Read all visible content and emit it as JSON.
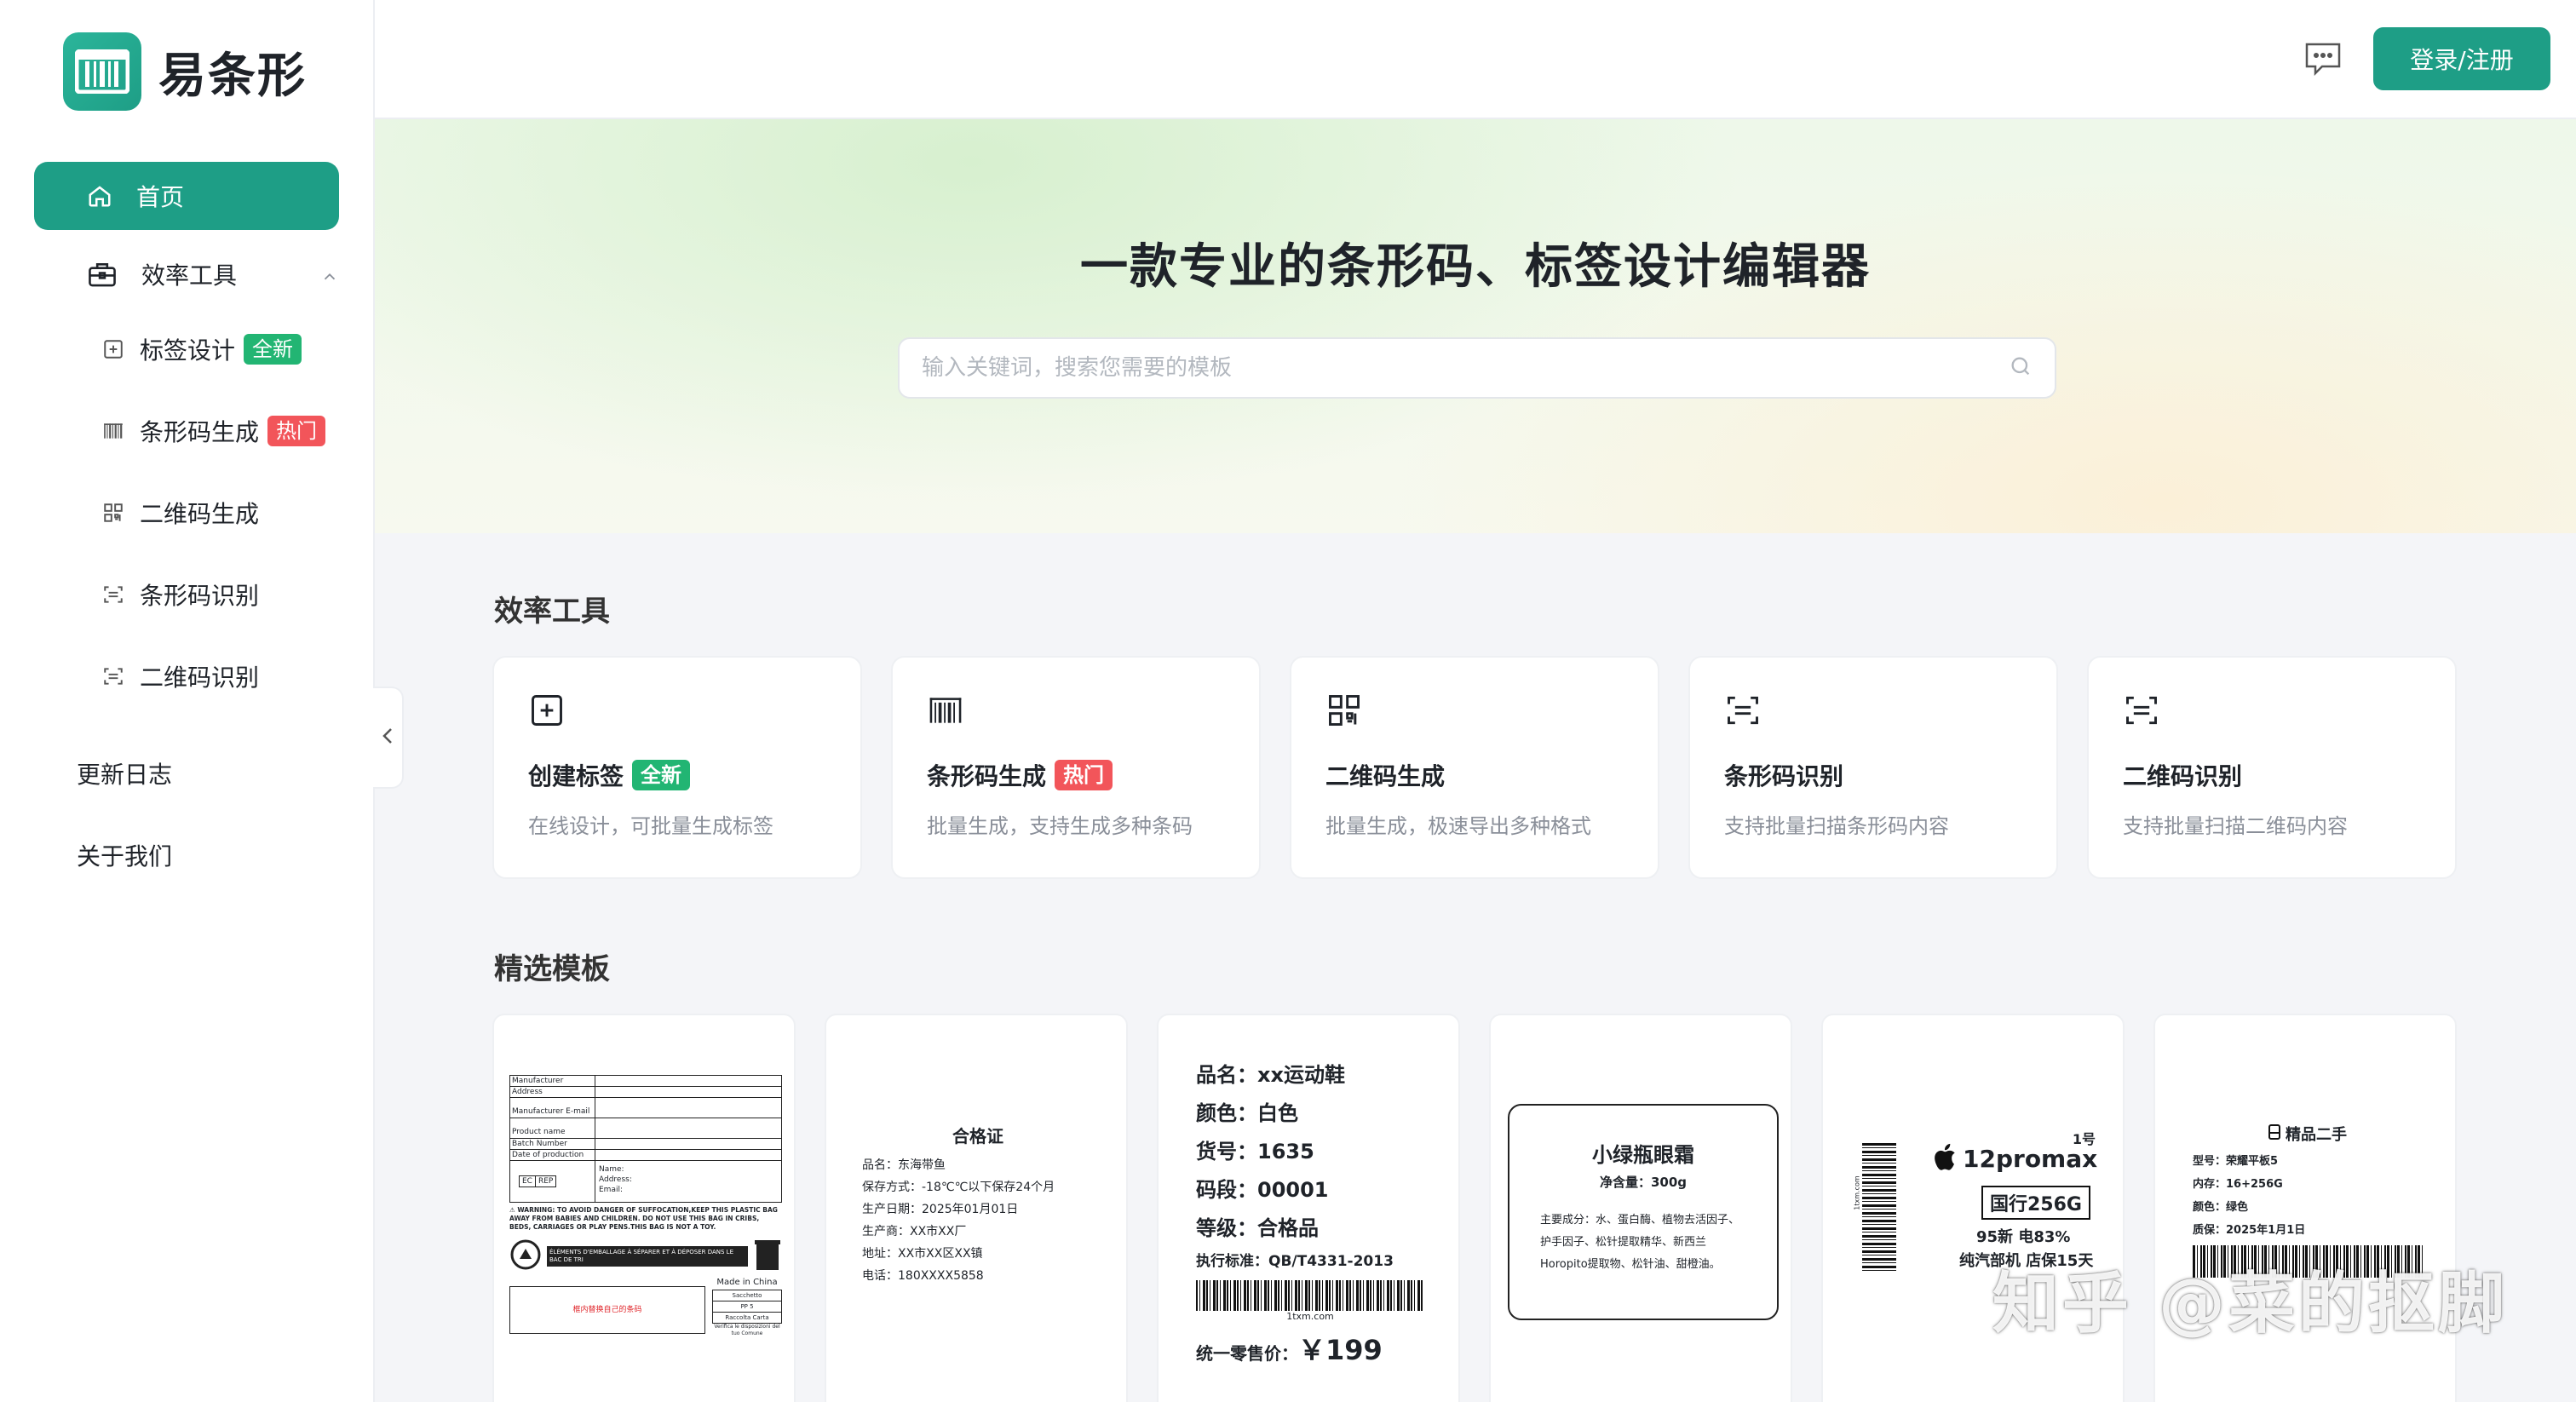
{
  "brand": {
    "name": "易条形"
  },
  "sidebar": {
    "home": "首页",
    "group": "效率工具",
    "items": [
      {
        "label": "标签设计",
        "badge": "全新",
        "badge_type": "new",
        "icon": "plus-square-icon"
      },
      {
        "label": "条形码生成",
        "badge": "热门",
        "badge_type": "hot",
        "icon": "barcode-icon"
      },
      {
        "label": "二维码生成",
        "badge": "",
        "icon": "qrcode-icon"
      },
      {
        "label": "条形码识别",
        "badge": "",
        "icon": "scan-icon"
      },
      {
        "label": "二维码识别",
        "badge": "",
        "icon": "scan-icon"
      }
    ],
    "changelog": "更新日志",
    "about": "关于我们"
  },
  "header": {
    "login": "登录/注册"
  },
  "hero": {
    "title": "一款专业的条形码、标签设计编辑器",
    "search_placeholder": "输入关键词，搜索您需要的模板"
  },
  "tools_section": {
    "title": "效率工具",
    "tools": [
      {
        "title": "创建标签",
        "badge": "全新",
        "desc": "在线设计，可批量生成标签"
      },
      {
        "title": "条形码生成",
        "badge": "热门",
        "desc": "批量生成，支持生成多种条码"
      },
      {
        "title": "二维码生成",
        "badge": "",
        "desc": "批量生成，极速导出多种格式"
      },
      {
        "title": "条形码识别",
        "badge": "",
        "desc": "支持批量扫描条形码内容"
      },
      {
        "title": "二维码识别",
        "badge": "",
        "desc": "支持批量扫描二维码内容"
      }
    ]
  },
  "templates_section": {
    "title": "精选模板",
    "t1": {
      "rows": [
        "Manufacturer",
        "Address",
        "Manufacturer E-mail",
        "Product name",
        "Batch Number",
        "Date of production"
      ],
      "ec": "EC",
      "rep": "REP",
      "fields": "Name:\nAddress:\nEmail:",
      "warning": "⚠ WARNING: TO AVOID DANGER OF SUFFOCATION,KEEP THIS PLASTIC BAG AWAY FROM BABIES AND CHILDREN. DO NOT USE THIS BAG IN CRIBS, BEDS, CARRIAGES OR PLAY PENS.THIS BAG IS NOT A TOY.",
      "recycle": "ÉLÉMENTS D'EMBALLAGE À SÉPARER ET À DÉPOSER DANS LE BAC DE TRI",
      "made": "Made in China",
      "red": "框内替换自己的条码",
      "mat": [
        "Sacchetto",
        "PP 5",
        "Raccolta Carta"
      ],
      "foot": "Verifica le disposizioni del tuo Comune"
    },
    "t2": {
      "title": "合格证",
      "lines": [
        "品名：东海带鱼",
        "保存方式：-18℃℃以下保存24个月",
        "生产日期：2025年01月01日",
        "生产商：XX市XX厂",
        "地址：XX市XX区XX镇",
        "电话：180XXXX5858"
      ]
    },
    "t3": {
      "lines": [
        "品名：xx运动鞋",
        "颜色：白色",
        "货号：1635",
        "码段：00001",
        "等级：合格品"
      ],
      "standard": "执行标准：QB/T4331-2013",
      "site": "1txm.com",
      "price_label": "统一零售价：",
      "price": "￥199"
    },
    "t4": {
      "title": "小绿瓶眼霜",
      "net": "净含量：300g",
      "ingredients": "主要成分：水、蛋白酶、植物去活因子、护手因子、松针提取精华、新西兰Horopito提取物、松针油、甜橙油。"
    },
    "t5": {
      "no": "1号",
      "model": "12promax",
      "spec": "国行256G",
      "cond": "95新 电83%",
      "note": "纯汽部机 店保15天",
      "side": "1txm.com"
    },
    "t6": {
      "title": "精品二手",
      "lines": [
        "型号：荣耀平板5",
        "内存：16+256G",
        "颜色：绿色",
        "质保：2025年1月1日"
      ]
    }
  },
  "watermark": "知乎 @菜的抠脚"
}
